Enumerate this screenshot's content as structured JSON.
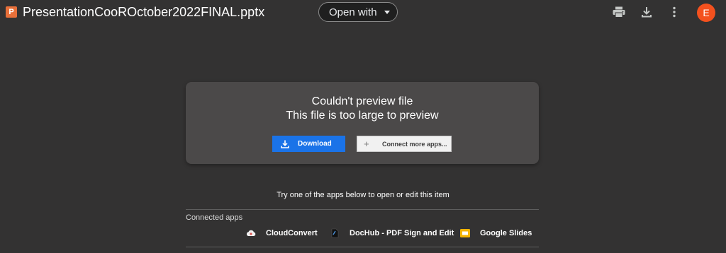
{
  "header": {
    "file_icon_letter": "P",
    "file_name": "PresentationCooROctober2022FINAL.pptx",
    "open_with_label": "Open with",
    "icons": [
      "print-icon",
      "download-icon",
      "more-vert-icon"
    ],
    "avatar_letter": "E"
  },
  "preview": {
    "title": "Couldn't preview file",
    "subtitle": "This file is too large to preview",
    "download_label": "Download",
    "connect_label": "Connect more apps..."
  },
  "apps": {
    "hint": "Try one of the apps below to open or edit this item",
    "section_label": "Connected apps",
    "items": [
      {
        "label": "CloudConvert",
        "icon": "cloudconvert-icon"
      },
      {
        "label": "DocHub - PDF Sign and Edit",
        "icon": "dochub-icon"
      },
      {
        "label": "Google Slides",
        "icon": "google-slides-icon"
      }
    ]
  },
  "colors": {
    "background": "#333232",
    "card": "#4b4949",
    "accent_blue": "#1a73e8",
    "file_icon": "#e8703a",
    "avatar": "#f4511e"
  }
}
